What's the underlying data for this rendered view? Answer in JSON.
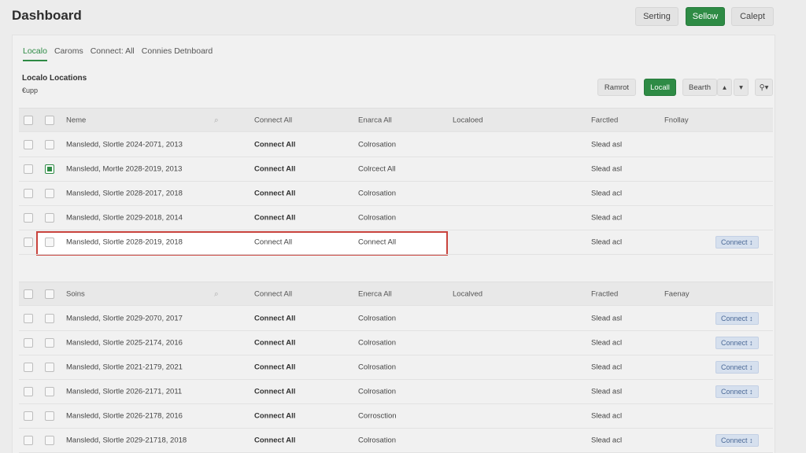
{
  "header": {
    "title": "Dashboard",
    "buttons": [
      "Serting",
      "Sellow",
      "Calept"
    ]
  },
  "tabs": [
    "Localo",
    "Caroms",
    "Connect: All",
    "Connies Detnboard"
  ],
  "section": {
    "title": "Localo Locations",
    "subtitle": "€upp"
  },
  "toolbar": {
    "buttons": [
      "Ramrot",
      "Locall",
      "Bearth"
    ],
    "icons": [
      "sort-up-icon",
      "chevron-down-icon",
      "search-icon"
    ]
  },
  "table1": {
    "headers": [
      "Neme",
      "Connect All",
      "Enarca All",
      "Localoed",
      "Farctled",
      "Fnollay"
    ],
    "rows": [
      {
        "name": "Mansledd, Slortle 2024-2071, 2013",
        "c1": "Connect All",
        "c2": "Colrosation",
        "c3": "",
        "c4": "Slead asl",
        "pill": "",
        "checked": false,
        "highlight": false
      },
      {
        "name": "Mansledd, Mortle 2028-2019, 2013",
        "c1": "Connect All",
        "c2": "Colrcect All",
        "c3": "",
        "c4": "Slead asl",
        "pill": "",
        "checked": true,
        "highlight": false
      },
      {
        "name": "Mansledd, Slortle 2028-2017, 2018",
        "c1": "Connect All",
        "c2": "Colrosation",
        "c3": "",
        "c4": "Slead acl",
        "pill": "",
        "checked": false,
        "highlight": false
      },
      {
        "name": "Mansledd, Slortle 2029-2018, 2014",
        "c1": "Connect All",
        "c2": "Colrosation",
        "c3": "",
        "c4": "Slead acl",
        "pill": "",
        "checked": false,
        "highlight": false
      },
      {
        "name": "Mansledd, Slortle 2028-2019, 2018",
        "c1": "Connect All",
        "c2": "Connect All",
        "c3": "",
        "c4": "Slead acl",
        "pill": "Connect ↕",
        "checked": false,
        "highlight": true
      }
    ]
  },
  "table2": {
    "headers": [
      "Soins",
      "Connect All",
      "Enerca All",
      "Localved",
      "Fractled",
      "Faenay"
    ],
    "rows": [
      {
        "name": "Mansledd, Slortle 2029-2070, 2017",
        "c1": "Connect All",
        "c2": "Colrosation",
        "c3": "",
        "c4": "Slead asl",
        "pill": "Connect ↕",
        "checked": false
      },
      {
        "name": "Mansledd, Slortle 2025-2174, 2016",
        "c1": "Connect All",
        "c2": "Colrosation",
        "c3": "",
        "c4": "Slead acl",
        "pill": "Connect ↕",
        "checked": false
      },
      {
        "name": "Mansledd, Slortle 2021-2179, 2021",
        "c1": "Connect All",
        "c2": "Colrosation",
        "c3": "",
        "c4": "Slead acl",
        "pill": "Connect ↕",
        "checked": false
      },
      {
        "name": "Mansledd, Slortle 2026-2171, 2011",
        "c1": "Connect All",
        "c2": "Colrosation",
        "c3": "",
        "c4": "Slead asl",
        "pill": "Connect ↕",
        "checked": false
      },
      {
        "name": "Mansledd, Slortle 2026-2178, 2016",
        "c1": "Connect All",
        "c2": "Corrosction",
        "c3": "",
        "c4": "Slead acl",
        "pill": "",
        "checked": false
      },
      {
        "name": "Mansledd, Slortle 2029-21718, 2018",
        "c1": "Connect All",
        "c2": "Colrosation",
        "c3": "",
        "c4": "Slead acl",
        "pill": "Connect ↕",
        "checked": false
      }
    ]
  },
  "colors": {
    "accent": "#2e8b45",
    "highlight": "#c9433d",
    "pill": "#d6e0ee"
  }
}
